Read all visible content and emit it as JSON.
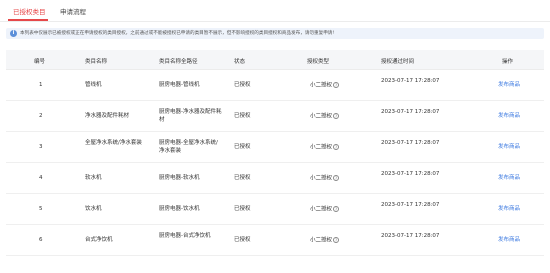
{
  "tabs": [
    {
      "label": "已授权类目",
      "active": true
    },
    {
      "label": "申请流程",
      "active": false
    }
  ],
  "notice": {
    "text": "本列表中仅展示已被授权或正在申请授权的类目授权，之前通过或不能被授权已申请的类目暂不展示，但不影响授权的类目授权和商品发布，请勿重复申请!"
  },
  "table": {
    "headers": [
      "编号",
      "类目名称",
      "类目名称全路径",
      "状态",
      "授权类型",
      "授权通过时间",
      "操作"
    ],
    "rows": [
      {
        "no": "1",
        "name": "管线机",
        "path": "厨房电器-管线机",
        "status": "已授权",
        "auth_type": "小二授权",
        "time": "2023-07-17 17:28:07",
        "action": "发布商品"
      },
      {
        "no": "2",
        "name": "净水器及配件耗材",
        "path": "厨房电器-净水器及配件耗材",
        "status": "已授权",
        "auth_type": "小二授权",
        "time": "2023-07-17 17:28:07",
        "action": "发布商品"
      },
      {
        "no": "3",
        "name": "全屋净水系统/净水套装",
        "path": "厨房电器-全屋净水系统/净水套装",
        "status": "已授权",
        "auth_type": "小二授权",
        "time": "2023-07-17 17:28:07",
        "action": "发布商品"
      },
      {
        "no": "4",
        "name": "软水机",
        "path": "厨房电器-软水机",
        "status": "已授权",
        "auth_type": "小二授权",
        "time": "2023-07-17 17:28:07",
        "action": "发布商品"
      },
      {
        "no": "5",
        "name": "饮水机",
        "path": "厨房电器-饮水机",
        "status": "已授权",
        "auth_type": "小二授权",
        "time": "2023-07-17 17:28:07",
        "action": "发布商品"
      },
      {
        "no": "6",
        "name": "台式净饮机",
        "path": "厨房电器-台式净饮机",
        "status": "已授权",
        "auth_type": "小二授权",
        "time": "2023-07-17 17:28:07",
        "action": "发布商品"
      }
    ]
  },
  "icons": {
    "info": "info-icon",
    "help": "question-circle-icon"
  },
  "colors": {
    "accent": "#e6484a",
    "link": "#3a78e0",
    "notice_bg": "#eef3fb"
  }
}
